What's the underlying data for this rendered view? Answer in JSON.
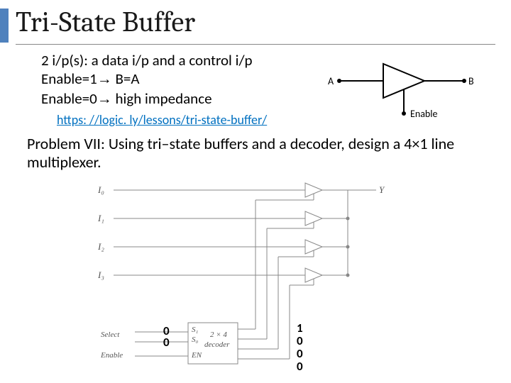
{
  "title": "Tri-State Buffer",
  "bullets": {
    "line1": "2 i/p(s): a data i/p and a control i/p",
    "line2a": "Enable=1",
    "line2b": " B=A",
    "line3a": "Enable=0",
    "line3b": " high impedance"
  },
  "link_text": "https: //logic. ly/lessons/tri-state-buffer/",
  "problem_text": "Problem VII: Using tri–state buffers and a decoder, design a 4×1 line multiplexer.",
  "sym": {
    "A": "A",
    "B": "B",
    "Enable": "Enable"
  },
  "mux": {
    "I0": "I₀",
    "I1": "I₁",
    "I2": "I₂",
    "I3": "I₃",
    "Select": "Select",
    "Enable": "Enable",
    "S1": "S₁",
    "S0": "S₀",
    "EN": "EN",
    "dec": "2 × 4",
    "decoder": "decoder",
    "Y": "Y"
  },
  "overlay": {
    "sel_top": "0",
    "sel_bot": "0",
    "d0": "1",
    "d1": "0",
    "d2": "0",
    "d3": "0"
  },
  "arrow_glyph": "→"
}
